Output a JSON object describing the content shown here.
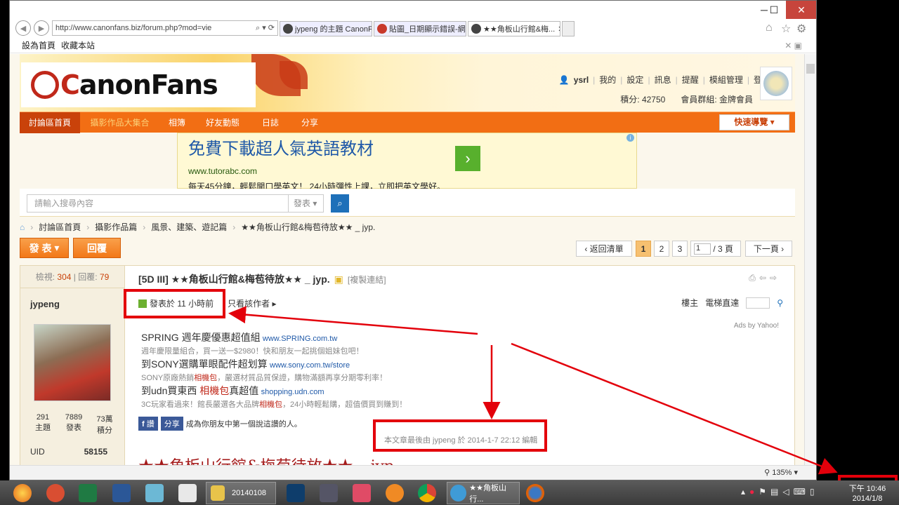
{
  "browser": {
    "url": "http://www.canonfans.biz/forum.php?mod=vie",
    "tabs": [
      "jypeng 的主題 CanonF...",
      "貼圖_日期顯示錯誤-網...",
      "★★角板山行館&梅..."
    ],
    "favorites": [
      "設為首頁",
      "收藏本站"
    ],
    "zoom": "135%"
  },
  "site": {
    "logo": "CanonFans",
    "user": "ysrl",
    "user_menu": [
      "我的",
      "設定",
      "訊息",
      "提醒",
      "模組管理",
      "登出"
    ],
    "points": "積分: 42750",
    "group": "會員群組: 金牌會員",
    "nav": [
      "討論區首頁",
      "攝影作品大集合",
      "相簿",
      "好友動態",
      "日誌",
      "分享"
    ],
    "quick_nav": "快速導覽"
  },
  "ad": {
    "title": "免費下載超人氣英語教材",
    "url": "www.tutorabc.com",
    "desc": "每天45分鐘，輕鬆開口學英文！ 24小時彈性上課，立即把英文學好。"
  },
  "search": {
    "placeholder": "請輸入搜尋內容",
    "type": "發表"
  },
  "breadcrumb": [
    "討論區首頁",
    "攝影作品篇",
    "風景、建築、遊記篇",
    "★★角板山行館&梅苞待放★★ _ jyp."
  ],
  "actions": {
    "post": "發 表",
    "reply": "回覆"
  },
  "pager": {
    "back": "返回清單",
    "pages": [
      "1",
      "2",
      "3"
    ],
    "current": "1",
    "total": "/ 3 頁",
    "next": "下一頁"
  },
  "thread": {
    "views_label": "檢視:",
    "views": "304",
    "replies_label": "回覆:",
    "replies": "79",
    "title": "[5D III] ★★角板山行館&梅苞待放★★ _ jyp.",
    "copy": "[複製連結]",
    "author": "jypeng",
    "posted": "發表於 11 小時前",
    "only_author": "只看該作者",
    "floor_label": "樓主",
    "jump_label": "電梯直達",
    "ads_by": "Ads by Yahoo!",
    "ads": [
      {
        "h": "SPRING 週年慶優惠超值組",
        "u": "www.SPRING.com.tw",
        "d": "週年慶限量組合，買一送一$2980！快和朋友一起挑個姐妹包吧！"
      },
      {
        "h": "到SONY選購單眼配件超划算",
        "u": "www.sony.com.tw/store",
        "d1": "SONY原廠熱銷",
        "dr": "相機包",
        "d2": "，嚴選材質品質保證，購物滿額再享分期零利率！"
      },
      {
        "h1": "到udn買東西 ",
        "hr": "相機包",
        "h2": "真超值",
        "u": "shopping.udn.com",
        "d1": "3C玩家看過來！館長嚴選各大品牌",
        "dr": "相機包",
        "d2": "，24小時輕鬆購，超值價買到賺到！"
      }
    ],
    "fb_like": "讚",
    "fb_share": "分享",
    "fb_text": "成為你朋友中第一個說這讚的人。",
    "edited": "本文章最後由 jypeng 於 2014-1-7 22:12 編輯",
    "big_title": "★★角板山行館&梅苞待放★★ _ jyp"
  },
  "profile": {
    "topics": "291",
    "topics_label": "主題",
    "posts": "7889",
    "posts_label": "發表",
    "points": "73萬",
    "points_label": "積分",
    "uid_label": "UID",
    "uid": "58155"
  },
  "taskbar": {
    "folder": "20140108",
    "ie": "★★角板山行...",
    "time": "下午 10:46",
    "date": "2014/1/8"
  }
}
